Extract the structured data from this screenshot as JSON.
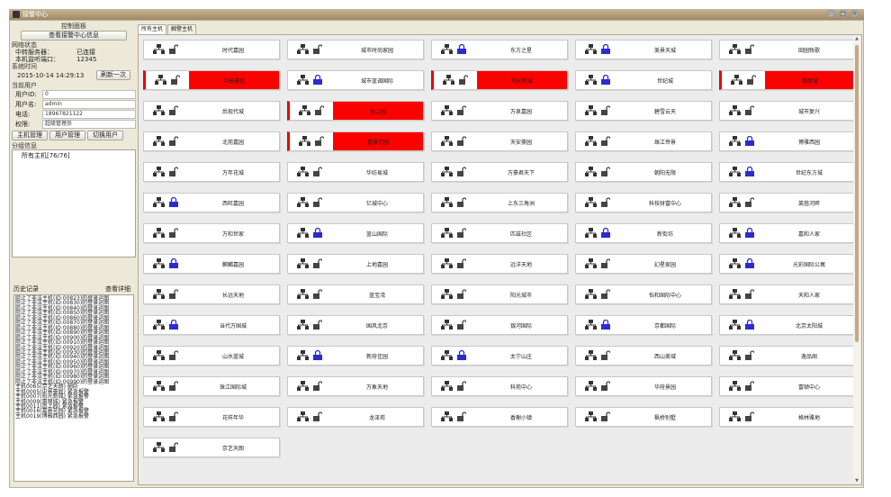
{
  "window": {
    "title": "接警中心"
  },
  "left": {
    "panel_title": "控制面板",
    "view_info_btn": "查看接警中心信息",
    "network_section": "网络状态",
    "relay_server_label": "中转服务器：",
    "relay_server_value": "已连接",
    "local_port_label": "本机监听端口：",
    "local_port_value": "12345",
    "system_time_label": "系统时间",
    "system_time_value": "2015-10-14 14:29:13",
    "refresh_btn": "刷新一次",
    "current_user_section": "当前用户",
    "user_id_label": "用户ID:",
    "user_id_value": "0",
    "username_label": "用户名:",
    "username_value": "admin",
    "phone_label": "电话:",
    "phone_value": "18967821122",
    "perm_label": "权限:",
    "perm_value": "超级管理员",
    "host_mgmt_btn": "主机管理",
    "user_mgmt_btn": "用户管理",
    "switch_user_btn": "切换用户",
    "group_section": "分组信息",
    "group_item": "所有主机[76/76]",
    "history_section": "历史记录",
    "history_detail": "查看详细",
    "history": [
      "阻止了非法主机(ID:00823)的登录运图",
      "阻止了非法主机(ID:00830)的登录运图",
      "阻止了非法主机(ID:00840)的登录运图",
      "阻止了非法主机(ID:00850)的登录运图",
      "阻止了非法主机(ID:00860)的登录运图",
      "阻止了非法主机(ID:00870)的登录运图",
      "阻止了非法主机(ID:00880)的登录运图",
      "阻止了非法主机(ID:00890)的登录运图",
      "阻止了非法主机(ID:00900)的登录运图",
      "阻止了非法主机(ID:00910)的登录运图",
      "阻止了非法主机(ID:00920)的登录运图",
      "阻止了非法主机(ID:00930)的登录运图",
      "阻止了非法主机(ID:00940)的登录运图",
      "阻止了非法主机(ID:00950)的登录运图",
      "阻止了非法主机(ID:00960)的登录运图",
      "阻止了非法主机(ID:00970)的登录运图",
      "阻止了非法主机(ID:00980)的登录运图",
      "阻止了非法主机(ID:00990)的登录运图",
      "主机0065(京艺天朗) 删防",
      "主机0005(中景豪庭) 紧急报警",
      "主机0007(阳光新城) 紧急报警",
      "主机0009(惠丽城) 紧急报警",
      "主机0011(尚上园) 紧急报警",
      "主机0016(富景花园) 紧急报警",
      "主机0019(博雅西园) 紧急报警"
    ]
  },
  "tabs": [
    "所有主机",
    "触警主机"
  ],
  "tiles": [
    {
      "name": "时代嘉园",
      "alarm": false,
      "armed": false
    },
    {
      "name": "城市时尚家园",
      "alarm": false,
      "armed": false
    },
    {
      "name": "东方之星",
      "alarm": false,
      "armed": true
    },
    {
      "name": "美景天城",
      "alarm": false,
      "armed": true
    },
    {
      "name": "田园牧歌",
      "alarm": false,
      "armed": false
    },
    {
      "name": "中景豪庭",
      "alarm": true,
      "armed": false
    },
    {
      "name": "城市蓝调国际",
      "alarm": false,
      "armed": true
    },
    {
      "name": "阳光新城",
      "alarm": true,
      "armed": false
    },
    {
      "name": "世纪城",
      "alarm": false,
      "armed": true
    },
    {
      "name": "惠丽城",
      "alarm": true,
      "armed": false
    },
    {
      "name": "后现代城",
      "alarm": false,
      "armed": false
    },
    {
      "name": "尚上园",
      "alarm": true,
      "armed": false
    },
    {
      "name": "万泉嘉园",
      "alarm": false,
      "armed": false
    },
    {
      "name": "碧雪云天",
      "alarm": false,
      "armed": false
    },
    {
      "name": "城市复兴",
      "alarm": false,
      "armed": false
    },
    {
      "name": "北苑嘉园",
      "alarm": false,
      "armed": false
    },
    {
      "name": "富景花园",
      "alarm": true,
      "armed": false
    },
    {
      "name": "天安豪园",
      "alarm": false,
      "armed": false
    },
    {
      "name": "珠江帝景",
      "alarm": false,
      "armed": false
    },
    {
      "name": "博雅西园",
      "alarm": false,
      "armed": true
    },
    {
      "name": "万年花城",
      "alarm": false,
      "armed": false
    },
    {
      "name": "华纺易城",
      "alarm": false,
      "armed": false
    },
    {
      "name": "万豪君天下",
      "alarm": false,
      "armed": false
    },
    {
      "name": "朝阳无限",
      "alarm": false,
      "armed": false
    },
    {
      "name": "世纪东方城",
      "alarm": false,
      "armed": true
    },
    {
      "name": "西旺嘉园",
      "alarm": false,
      "armed": true
    },
    {
      "name": "亿城中心",
      "alarm": false,
      "armed": false
    },
    {
      "name": "上东三角洲",
      "alarm": false,
      "armed": false
    },
    {
      "name": "科技财富中心",
      "alarm": false,
      "armed": false
    },
    {
      "name": "莱茵河畔",
      "alarm": false,
      "armed": false
    },
    {
      "name": "万和世家",
      "alarm": false,
      "armed": false
    },
    {
      "name": "蓝山国际",
      "alarm": false,
      "armed": true
    },
    {
      "name": "匹兹社区",
      "alarm": false,
      "armed": false
    },
    {
      "name": "新街坊",
      "alarm": false,
      "armed": true
    },
    {
      "name": "嘉和人家",
      "alarm": false,
      "armed": true
    },
    {
      "name": "麒麟嘉园",
      "alarm": false,
      "armed": true
    },
    {
      "name": "上地嘉园",
      "alarm": false,
      "armed": false
    },
    {
      "name": "远洋天地",
      "alarm": false,
      "armed": false
    },
    {
      "name": "幻星家园",
      "alarm": false,
      "armed": false
    },
    {
      "name": "光彩国际公寓",
      "alarm": false,
      "armed": true
    },
    {
      "name": "长远天地",
      "alarm": false,
      "armed": false
    },
    {
      "name": "蓝宝湾",
      "alarm": false,
      "armed": false
    },
    {
      "name": "阳光城市",
      "alarm": false,
      "armed": false
    },
    {
      "name": "怡和国际中心",
      "alarm": false,
      "armed": false
    },
    {
      "name": "天和人家",
      "alarm": false,
      "armed": false
    },
    {
      "name": "当代万国城",
      "alarm": false,
      "armed": true
    },
    {
      "name": "国风北京",
      "alarm": false,
      "armed": false
    },
    {
      "name": "银河国际",
      "alarm": false,
      "armed": false
    },
    {
      "name": "京都国际",
      "alarm": false,
      "armed": true
    },
    {
      "name": "北京太阳城",
      "alarm": false,
      "armed": true
    },
    {
      "name": "山水蓝城",
      "alarm": false,
      "armed": false
    },
    {
      "name": "新府佳园",
      "alarm": false,
      "armed": true
    },
    {
      "name": "太宁山庄",
      "alarm": false,
      "armed": true
    },
    {
      "name": "西山美域",
      "alarm": false,
      "armed": false
    },
    {
      "name": "逸品阁",
      "alarm": false,
      "armed": false
    },
    {
      "name": "珠江国际城",
      "alarm": false,
      "armed": false
    },
    {
      "name": "万象天地",
      "alarm": false,
      "armed": false
    },
    {
      "name": "科苑中心",
      "alarm": false,
      "armed": false
    },
    {
      "name": "华府景园",
      "alarm": false,
      "armed": false
    },
    {
      "name": "富顿中心",
      "alarm": false,
      "armed": false
    },
    {
      "name": "花样年华",
      "alarm": false,
      "armed": false
    },
    {
      "name": "龙泽苑",
      "alarm": false,
      "armed": false
    },
    {
      "name": "香榭小镇",
      "alarm": false,
      "armed": false
    },
    {
      "name": "枫桥别墅",
      "alarm": false,
      "armed": false
    },
    {
      "name": "格林雅地",
      "alarm": false,
      "armed": false
    },
    {
      "name": "京艺天朗",
      "alarm": false,
      "armed": false
    }
  ],
  "colors": {
    "alarm": "#ff0000",
    "armed_lock": "#2c2ccc",
    "disarmed_lock": "#444444"
  }
}
